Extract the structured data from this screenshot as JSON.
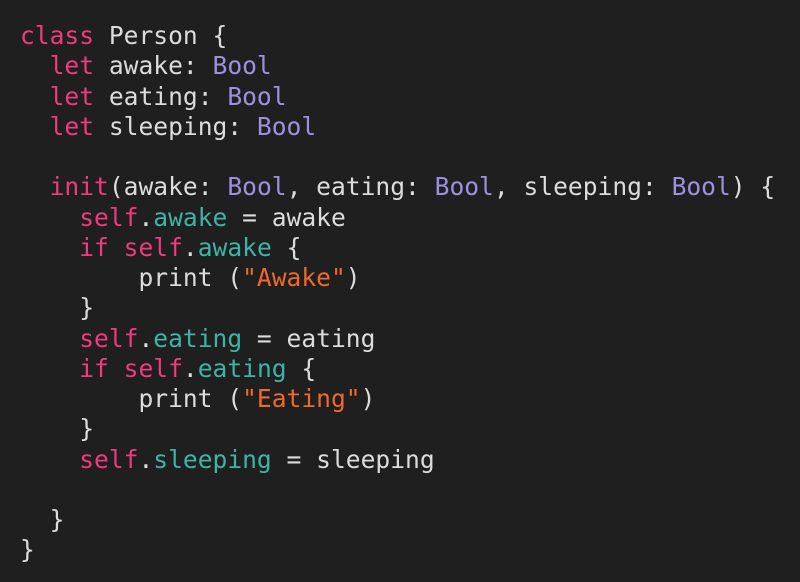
{
  "editor": {
    "language": "swift",
    "colors": {
      "background": "#1f1f1f",
      "plain": "#dcdcdc",
      "keyword": "#ef3a7e",
      "type": "#9f8fdf",
      "property": "#3fb3a6",
      "string": "#f0692a"
    },
    "lines": [
      [
        {
          "t": "class",
          "c": "keyword"
        },
        {
          "t": " Person {",
          "c": "plain"
        }
      ],
      [
        {
          "t": "  ",
          "c": "plain"
        },
        {
          "t": "let",
          "c": "keyword"
        },
        {
          "t": " awake: ",
          "c": "plain"
        },
        {
          "t": "Bool",
          "c": "type"
        }
      ],
      [
        {
          "t": "  ",
          "c": "plain"
        },
        {
          "t": "let",
          "c": "keyword"
        },
        {
          "t": " eating: ",
          "c": "plain"
        },
        {
          "t": "Bool",
          "c": "type"
        }
      ],
      [
        {
          "t": "  ",
          "c": "plain"
        },
        {
          "t": "let",
          "c": "keyword"
        },
        {
          "t": " sleeping: ",
          "c": "plain"
        },
        {
          "t": "Bool",
          "c": "type"
        }
      ],
      [],
      [
        {
          "t": "  ",
          "c": "plain"
        },
        {
          "t": "init",
          "c": "keyword"
        },
        {
          "t": "(awake: ",
          "c": "plain"
        },
        {
          "t": "Bool",
          "c": "type"
        },
        {
          "t": ", eating: ",
          "c": "plain"
        },
        {
          "t": "Bool",
          "c": "type"
        },
        {
          "t": ", sleeping: ",
          "c": "plain"
        },
        {
          "t": "Bool",
          "c": "type"
        },
        {
          "t": ") {",
          "c": "plain"
        }
      ],
      [
        {
          "t": "    ",
          "c": "plain"
        },
        {
          "t": "self",
          "c": "keyword"
        },
        {
          "t": ".",
          "c": "plain"
        },
        {
          "t": "awake",
          "c": "prop"
        },
        {
          "t": " = awake",
          "c": "plain"
        }
      ],
      [
        {
          "t": "    ",
          "c": "plain"
        },
        {
          "t": "if",
          "c": "keyword"
        },
        {
          "t": " ",
          "c": "plain"
        },
        {
          "t": "self",
          "c": "keyword"
        },
        {
          "t": ".",
          "c": "plain"
        },
        {
          "t": "awake",
          "c": "prop"
        },
        {
          "t": " {",
          "c": "plain"
        }
      ],
      [
        {
          "t": "        print (",
          "c": "plain"
        },
        {
          "t": "\"Awake\"",
          "c": "string"
        },
        {
          "t": ")",
          "c": "plain"
        }
      ],
      [
        {
          "t": "    }",
          "c": "plain"
        }
      ],
      [
        {
          "t": "    ",
          "c": "plain"
        },
        {
          "t": "self",
          "c": "keyword"
        },
        {
          "t": ".",
          "c": "plain"
        },
        {
          "t": "eating",
          "c": "prop"
        },
        {
          "t": " = eating",
          "c": "plain"
        }
      ],
      [
        {
          "t": "    ",
          "c": "plain"
        },
        {
          "t": "if",
          "c": "keyword"
        },
        {
          "t": " ",
          "c": "plain"
        },
        {
          "t": "self",
          "c": "keyword"
        },
        {
          "t": ".",
          "c": "plain"
        },
        {
          "t": "eating",
          "c": "prop"
        },
        {
          "t": " {",
          "c": "plain"
        }
      ],
      [
        {
          "t": "        print (",
          "c": "plain"
        },
        {
          "t": "\"Eating\"",
          "c": "string"
        },
        {
          "t": ")",
          "c": "plain"
        }
      ],
      [
        {
          "t": "    }",
          "c": "plain"
        }
      ],
      [
        {
          "t": "    ",
          "c": "plain"
        },
        {
          "t": "self",
          "c": "keyword"
        },
        {
          "t": ".",
          "c": "plain"
        },
        {
          "t": "sleeping",
          "c": "prop"
        },
        {
          "t": " = sleeping",
          "c": "plain"
        }
      ],
      [],
      [
        {
          "t": "  }",
          "c": "plain"
        }
      ],
      [
        {
          "t": "}",
          "c": "plain"
        }
      ]
    ]
  }
}
